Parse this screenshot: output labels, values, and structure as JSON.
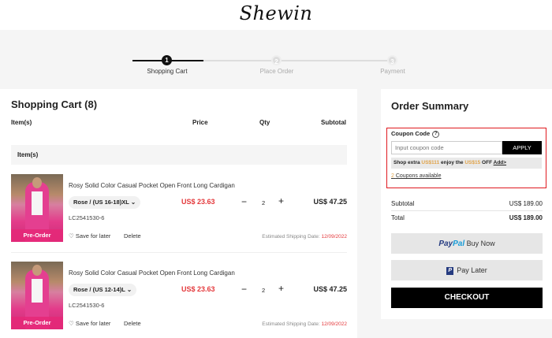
{
  "brand": {
    "logo": "Shewin"
  },
  "steps": [
    {
      "num": "1",
      "label": "Shopping Cart",
      "active": true
    },
    {
      "num": "2",
      "label": "Place Order",
      "active": false
    },
    {
      "num": "3",
      "label": "Payment",
      "active": false
    }
  ],
  "cart": {
    "title": "Shopping Cart (8)",
    "columns": {
      "items": "Item(s)",
      "price": "Price",
      "qty": "Qty",
      "subtotal": "Subtotal"
    },
    "group_label": "Item(s)",
    "items": [
      {
        "name": "Rosy Solid Color Casual Pocket Open Front Long Cardigan",
        "variant": "Rose / (US 16-18)XL",
        "sku": "LC2541530-6",
        "price": "US$ 23.63",
        "qty": "2",
        "subtotal": "US$ 47.25",
        "badge": "Pre-Order",
        "save": "Save for later",
        "delete": "Delete",
        "ship_label": "Estimated Shipping Date:",
        "ship_date": "12/09/2022"
      },
      {
        "name": "Rosy Solid Color Casual Pocket Open Front Long Cardigan",
        "variant": "Rose / (US 12-14)L",
        "sku": "LC2541530-6",
        "price": "US$ 23.63",
        "qty": "2",
        "subtotal": "US$ 47.25",
        "badge": "Pre-Order",
        "save": "Save for later",
        "delete": "Delete",
        "ship_label": "Estimated Shipping Date:",
        "ship_date": "12/09/2022"
      }
    ],
    "minus": "−",
    "plus": "+"
  },
  "summary": {
    "title": "Order Summary",
    "coupon_label": "Coupon Code",
    "help": "?",
    "coupon_placeholder": "Input coupon code",
    "apply": "APPLY",
    "promo_pre": "Shop extra",
    "promo_amount1": "US$111",
    "promo_mid": "enjoy the",
    "promo_amount2": "US$15",
    "promo_off": "OFF",
    "promo_add": "Add>",
    "coupons_count": "2",
    "coupons_text": "Coupons available",
    "subtotal_label": "Subtotal",
    "subtotal_value": "US$ 189.00",
    "total_label": "Total",
    "total_value": "US$ 189.00",
    "paypal_a": "Pay",
    "paypal_b": "Pal",
    "buy_now": "Buy Now",
    "pp_mark": "P",
    "pay_later": "Pay Later",
    "checkout": "CHECKOUT"
  },
  "colors": {
    "accent": "#e4393c",
    "highlight": "#e0191f",
    "dark": "#000000"
  }
}
